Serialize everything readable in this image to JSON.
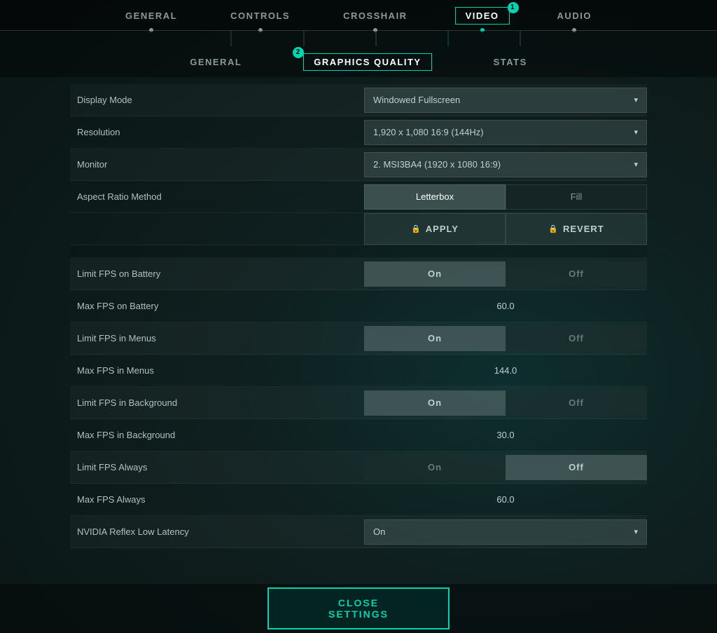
{
  "topNav": {
    "items": [
      {
        "id": "general",
        "label": "GENERAL",
        "active": false,
        "badge": null
      },
      {
        "id": "controls",
        "label": "CONTROLS",
        "active": false,
        "badge": null
      },
      {
        "id": "crosshair",
        "label": "CROSSHAIR",
        "active": false,
        "badge": null
      },
      {
        "id": "video",
        "label": "VIDEO",
        "active": true,
        "badge": "1"
      },
      {
        "id": "audio",
        "label": "AUDIO",
        "active": false,
        "badge": null
      }
    ]
  },
  "subNav": {
    "items": [
      {
        "id": "general",
        "label": "GENERAL",
        "active": false,
        "badge": null
      },
      {
        "id": "graphics",
        "label": "GRAPHICS QUALITY",
        "active": true,
        "badge": "2"
      },
      {
        "id": "stats",
        "label": "STATS",
        "active": false,
        "badge": null
      }
    ]
  },
  "settings": {
    "displayMode": {
      "label": "Display Mode",
      "value": "Windowed Fullscreen"
    },
    "resolution": {
      "label": "Resolution",
      "value": "1,920 x 1,080 16:9 (144Hz)"
    },
    "monitor": {
      "label": "Monitor",
      "value": "2. MSI3BA4 (1920 x  1080 16:9)"
    },
    "aspectRatioMethod": {
      "label": "Aspect Ratio Method",
      "letterbox": "Letterbox",
      "fill": "Fill",
      "selected": "letterbox"
    },
    "apply": "APPLY",
    "revert": "REVERT",
    "limitFPSBattery": {
      "label": "Limit FPS on Battery",
      "on": "On",
      "off": "Off",
      "selected": "on"
    },
    "maxFPSBattery": {
      "label": "Max FPS on Battery",
      "value": "60.0"
    },
    "limitFPSMenus": {
      "label": "Limit FPS in Menus",
      "on": "On",
      "off": "Off",
      "selected": "on"
    },
    "maxFPSMenus": {
      "label": "Max FPS in Menus",
      "value": "144.0"
    },
    "limitFPSBackground": {
      "label": "Limit FPS in Background",
      "on": "On",
      "off": "Off",
      "selected": "on"
    },
    "maxFPSBackground": {
      "label": "Max FPS in Background",
      "value": "30.0"
    },
    "limitFPSAlways": {
      "label": "Limit FPS Always",
      "on": "On",
      "off": "Off",
      "selected": "off"
    },
    "maxFPSAlways": {
      "label": "Max FPS Always",
      "value": "60.0"
    },
    "nvidiaReflex": {
      "label": "NVIDIA Reflex Low Latency",
      "value": "On"
    }
  },
  "closeButton": "CLOSE SETTINGS"
}
